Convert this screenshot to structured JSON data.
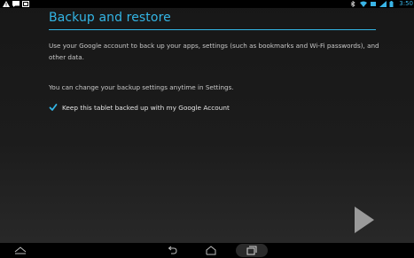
{
  "status_bar": {
    "time": "3:50"
  },
  "setup": {
    "title": "Backup and restore",
    "description": "Use your Google account to back up your apps, settings (such as bookmarks and Wi-Fi passwords), and other data.",
    "change_note": "You can change your backup settings anytime in Settings.",
    "backup_checkbox": {
      "label": "Keep this tablet backed up with my Google Account",
      "checked": true
    }
  },
  "colors": {
    "accent": "#33b5e5",
    "background": "#1a1a1a"
  },
  "nav": {
    "icons": [
      "menu-toggle-icon",
      "back-icon",
      "home-icon",
      "recent-apps-icon"
    ]
  }
}
